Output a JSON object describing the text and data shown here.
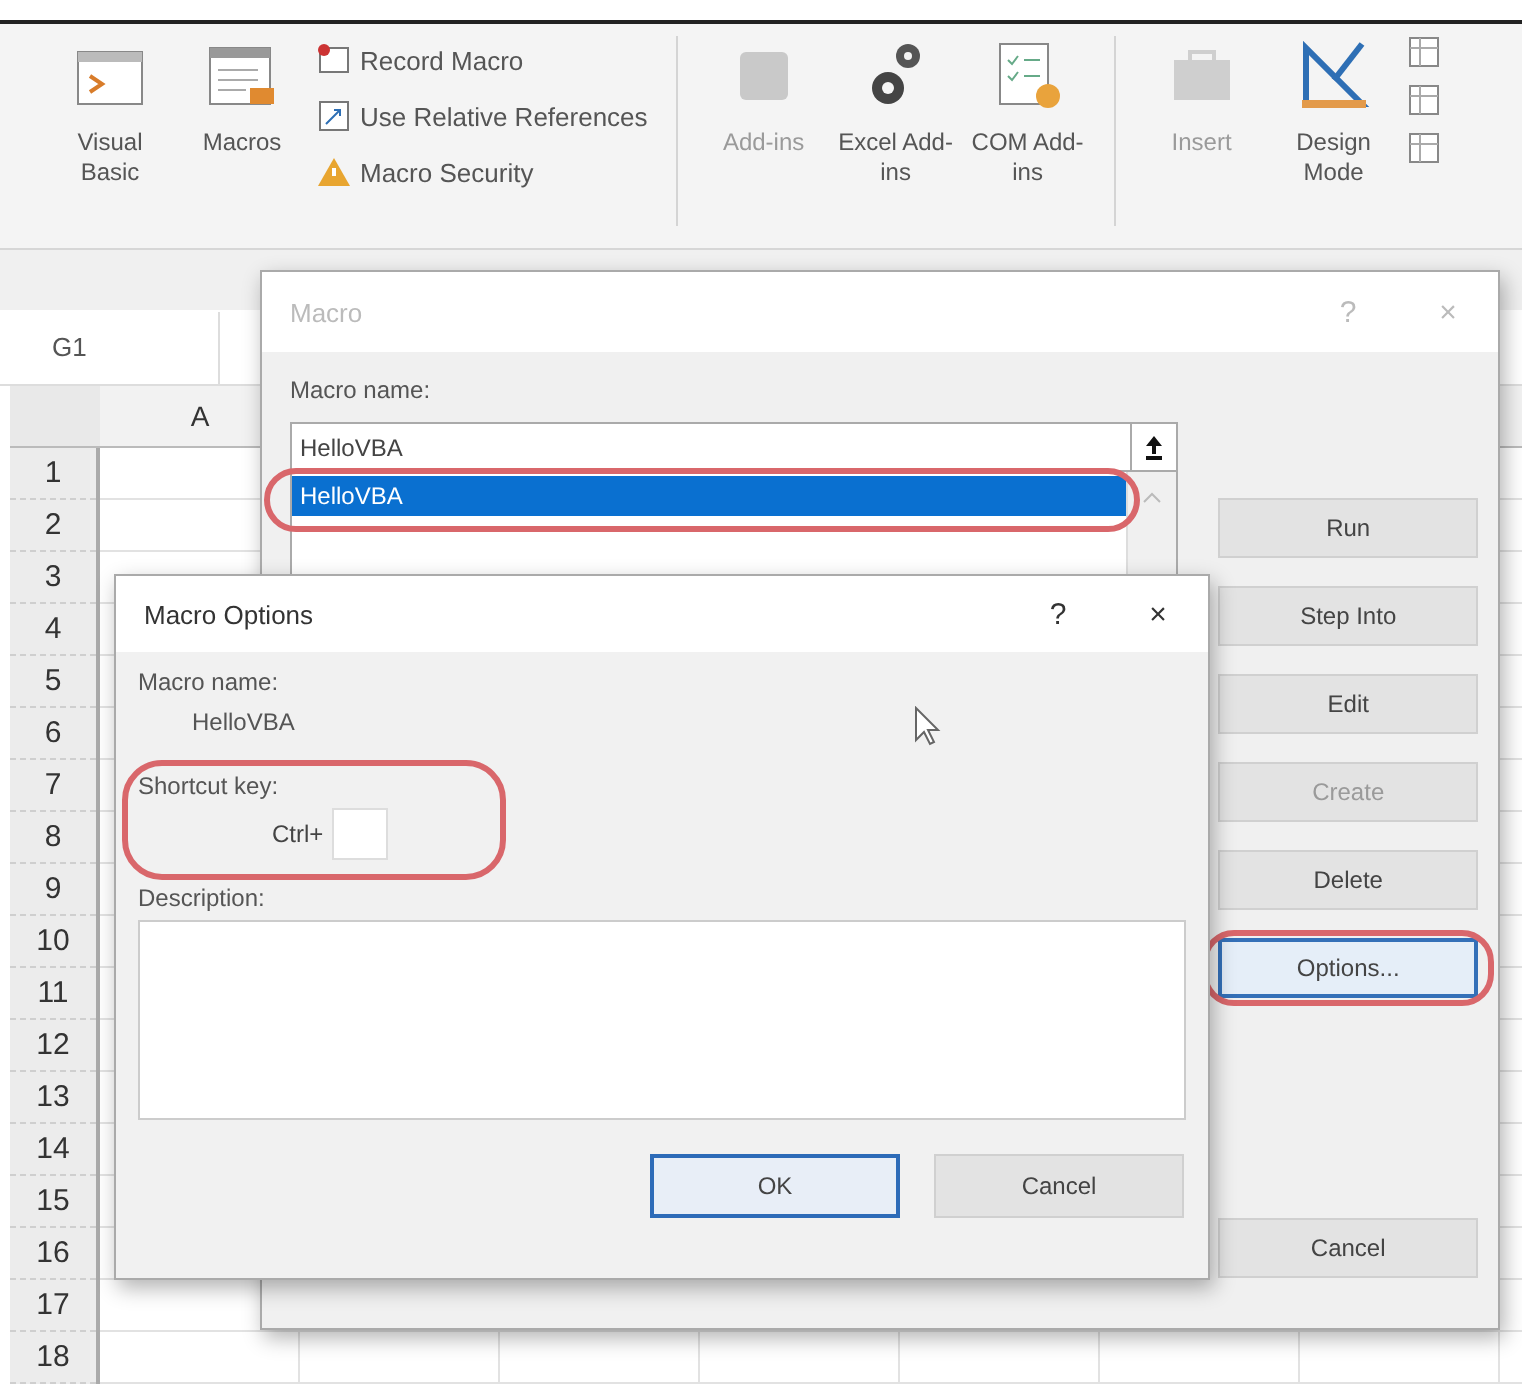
{
  "ribbon": {
    "groups": [
      {
        "items": [
          {
            "kind": "large",
            "label": "Visual Basic",
            "disabled": false
          },
          {
            "kind": "large",
            "label": "Macros",
            "disabled": false
          },
          {
            "kind": "small-stack",
            "entries": [
              {
                "label": "Record Macro"
              },
              {
                "label": "Use Relative References"
              },
              {
                "label": "Macro Security"
              }
            ]
          }
        ]
      },
      {
        "items": [
          {
            "kind": "large",
            "label": "Add-ins",
            "disabled": true
          },
          {
            "kind": "large",
            "label": "Excel Add-ins",
            "disabled": false
          },
          {
            "kind": "large",
            "label": "COM Add-ins",
            "disabled": false
          }
        ]
      },
      {
        "items": [
          {
            "kind": "large",
            "label": "Insert",
            "disabled": true
          },
          {
            "kind": "large",
            "label": "Design Mode",
            "disabled": false
          },
          {
            "kind": "icons-stack"
          }
        ]
      }
    ]
  },
  "name_box": {
    "value": "G1"
  },
  "columns": [
    "A"
  ],
  "rows": [
    "1",
    "2",
    "3",
    "4",
    "5",
    "6",
    "7",
    "8",
    "9",
    "10",
    "11",
    "12",
    "13",
    "14",
    "15",
    "16",
    "17",
    "18"
  ],
  "macro_dialog": {
    "title": "Macro",
    "help": "?",
    "close": "×",
    "name_label": "Macro name:",
    "name_value": "HelloVBA",
    "list": [
      {
        "label": "HelloVBA",
        "selected": true,
        "highlighted": true
      }
    ],
    "buttons": [
      {
        "label": "Run",
        "disabled": false,
        "highlighted": false,
        "bottom": false
      },
      {
        "label": "Step Into",
        "disabled": false,
        "highlighted": false,
        "bottom": false
      },
      {
        "label": "Edit",
        "disabled": false,
        "highlighted": false,
        "bottom": false
      },
      {
        "label": "Create",
        "disabled": true,
        "highlighted": false,
        "bottom": false
      },
      {
        "label": "Delete",
        "disabled": false,
        "highlighted": false,
        "bottom": false
      },
      {
        "label": "Options...",
        "disabled": false,
        "highlighted": true,
        "bottom": false
      }
    ],
    "bottom_buttons": [
      {
        "label": "Cancel"
      }
    ]
  },
  "options_dialog": {
    "title": "Macro Options",
    "help": "?",
    "close": "×",
    "name_label": "Macro name:",
    "name_value": "HelloVBA",
    "shortcut_label": "Shortcut key:",
    "shortcut_prefix": "Ctrl+",
    "shortcut_highlighted": true,
    "description_label": "Description:",
    "buttons": [
      {
        "label": "OK",
        "default": true
      },
      {
        "label": "Cancel",
        "default": false
      }
    ]
  }
}
